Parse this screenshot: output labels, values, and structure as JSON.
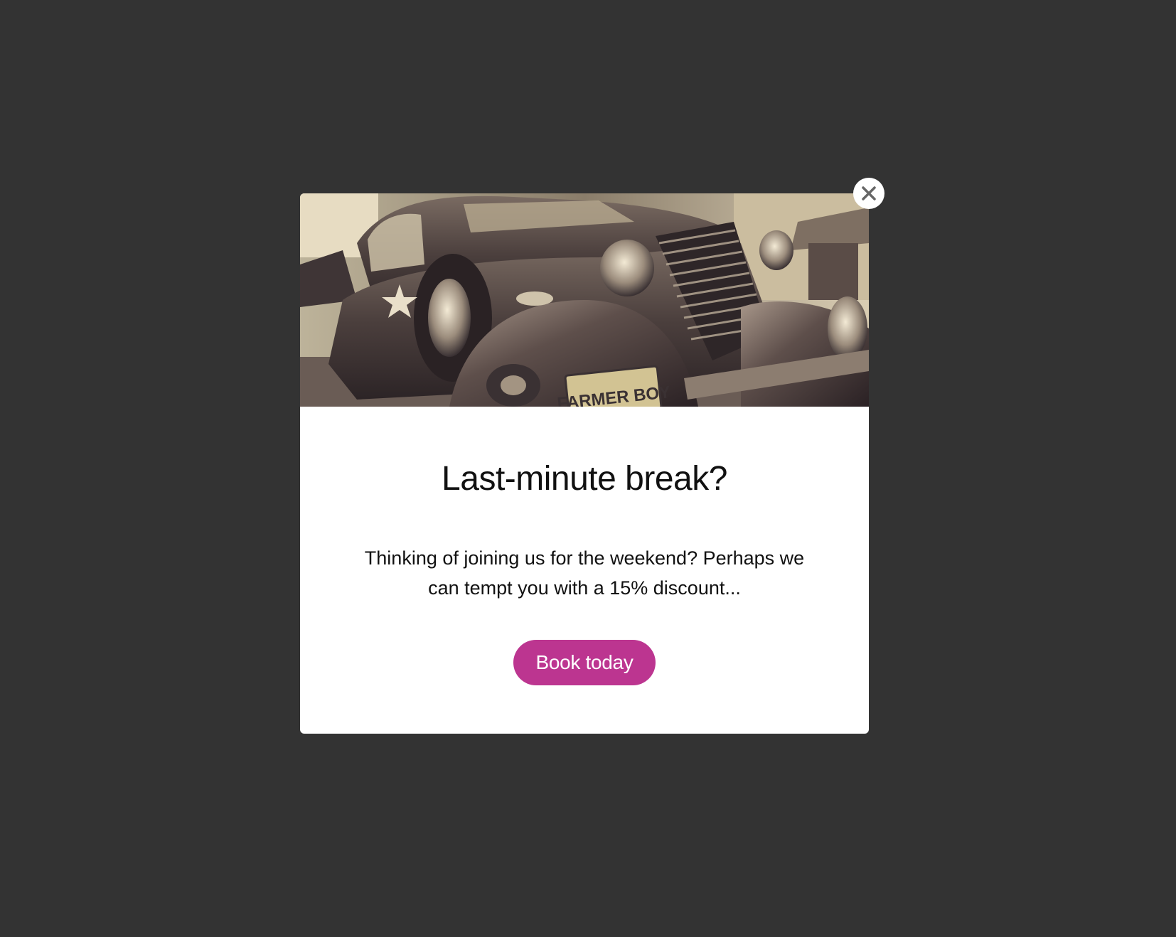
{
  "popup": {
    "title": "Last-minute break?",
    "body": "Thinking of joining us for the weekend? Perhaps we can tempt you with a 15% discount...",
    "cta_label": "Book today",
    "hero_plate_text": "FARMER BOY"
  },
  "icons": {
    "close": "close-icon"
  },
  "colors": {
    "backdrop": "#333333",
    "modal_background": "#ffffff",
    "cta_background": "#bc3590",
    "cta_text": "#ffffff",
    "close_icon": "#666666"
  }
}
